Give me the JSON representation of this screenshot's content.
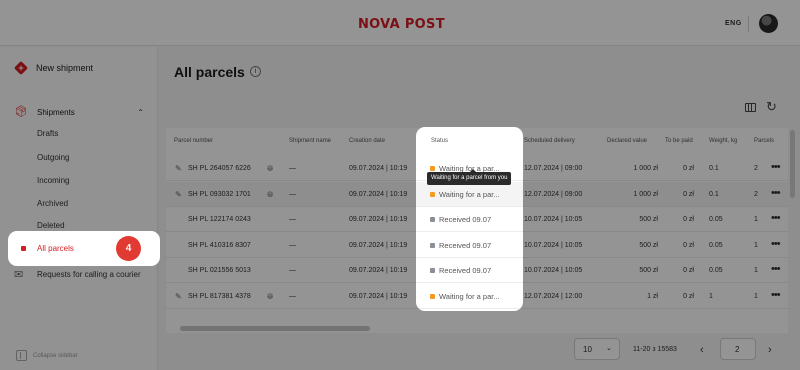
{
  "header": {
    "logo": "NOVA POST",
    "language": "ENG"
  },
  "sidebar": {
    "new_shipment": "New shipment",
    "shipments": "Shipments",
    "items": [
      {
        "label": "Drafts"
      },
      {
        "label": "Outgoing"
      },
      {
        "label": "Incoming"
      },
      {
        "label": "Archived"
      },
      {
        "label": "Deleted"
      }
    ],
    "all_parcels": "All parcels",
    "step_badge": "4",
    "courier": "Requests for calling a courier",
    "collapse": "Collapse sidebar"
  },
  "main": {
    "title": "All parcels",
    "columns": [
      "Parcel number",
      "Shipment name",
      "Creation date",
      "Status",
      "Scheduled delivery",
      "Declared value",
      "To be paid",
      "Weight, kg",
      "Parcels"
    ],
    "rows": [
      {
        "parcel": "SH PL 264057 6226",
        "name": "—",
        "created": "09.07.2024 | 10:19",
        "status": "Waiting for a par...",
        "status_color": "#f39c1f",
        "delivery": "12.07.2024 | 09:00",
        "declared": "1 000 zł",
        "to_pay": "0 zł",
        "weight": "0.1",
        "parcels": "2",
        "editable": true
      },
      {
        "parcel": "SH PL 093032 1701",
        "name": "—",
        "created": "09.07.2024 | 10:19",
        "status": "Waiting for a par...",
        "status_color": "#f39c1f",
        "delivery": "12.07.2024 | 09:00",
        "declared": "1 000 zł",
        "to_pay": "0 zł",
        "weight": "0.1",
        "parcels": "2",
        "editable": true
      },
      {
        "parcel": "SH PL 122174 0243",
        "name": "—",
        "created": "09.07.2024 | 10:19",
        "status": "Received 09.07",
        "status_color": "#8a8f98",
        "delivery": "10.07.2024 | 10:05",
        "declared": "500 zł",
        "to_pay": "0 zł",
        "weight": "0.05",
        "parcels": "1",
        "editable": false
      },
      {
        "parcel": "SH PL 410316 8307",
        "name": "—",
        "created": "09.07.2024 | 10:19",
        "status": "Received 09.07",
        "status_color": "#8a8f98",
        "delivery": "10.07.2024 | 10:05",
        "declared": "500 zł",
        "to_pay": "0 zł",
        "weight": "0.05",
        "parcels": "1",
        "editable": false
      },
      {
        "parcel": "SH PL 021556 5013",
        "name": "—",
        "created": "09.07.2024 | 10:19",
        "status": "Received 09.07",
        "status_color": "#8a8f98",
        "delivery": "10.07.2024 | 10:05",
        "declared": "500 zł",
        "to_pay": "0 zł",
        "weight": "0.05",
        "parcels": "1",
        "editable": false
      },
      {
        "parcel": "SH PL 817381 4378",
        "name": "—",
        "created": "09.07.2024 | 10:19",
        "status": "Waiting for a par...",
        "status_color": "#f39c1f",
        "delivery": "12.07.2024 | 12:00",
        "declared": "1 zł",
        "to_pay": "0 zł",
        "weight": "1",
        "parcels": "1",
        "editable": true
      }
    ],
    "tooltip": "Waiting for a parcel from you"
  },
  "pagination": {
    "per_page": "10",
    "range": "11-20 з 15583",
    "page": "2"
  },
  "colors": {
    "brand": "#d51d25",
    "badge": "#e03a32"
  }
}
